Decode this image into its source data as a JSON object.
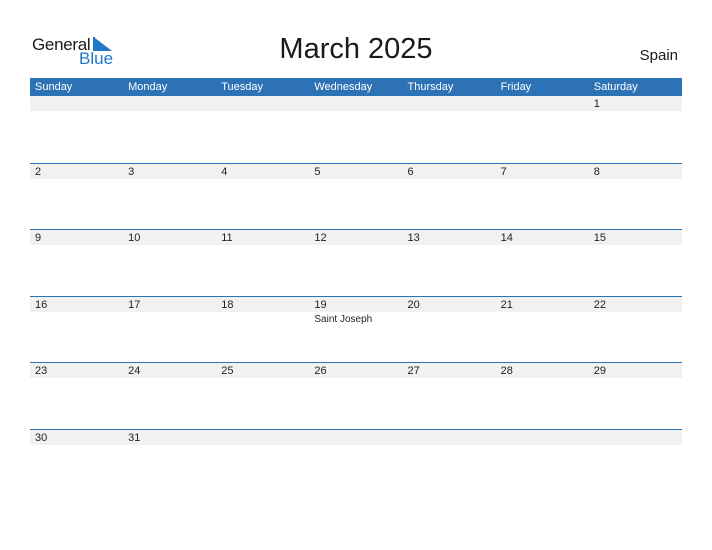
{
  "logo": {
    "word1": "General",
    "word2": "Blue"
  },
  "title": "March 2025",
  "country": "Spain",
  "weekdays": [
    "Sunday",
    "Monday",
    "Tuesday",
    "Wednesday",
    "Thursday",
    "Friday",
    "Saturday"
  ],
  "weeks": [
    [
      {
        "d": ""
      },
      {
        "d": ""
      },
      {
        "d": ""
      },
      {
        "d": ""
      },
      {
        "d": ""
      },
      {
        "d": ""
      },
      {
        "d": "1"
      }
    ],
    [
      {
        "d": "2"
      },
      {
        "d": "3"
      },
      {
        "d": "4"
      },
      {
        "d": "5"
      },
      {
        "d": "6"
      },
      {
        "d": "7"
      },
      {
        "d": "8"
      }
    ],
    [
      {
        "d": "9"
      },
      {
        "d": "10"
      },
      {
        "d": "11"
      },
      {
        "d": "12"
      },
      {
        "d": "13"
      },
      {
        "d": "14"
      },
      {
        "d": "15"
      }
    ],
    [
      {
        "d": "16"
      },
      {
        "d": "17"
      },
      {
        "d": "18"
      },
      {
        "d": "19",
        "ev": "Saint Joseph"
      },
      {
        "d": "20"
      },
      {
        "d": "21"
      },
      {
        "d": "22"
      }
    ],
    [
      {
        "d": "23"
      },
      {
        "d": "24"
      },
      {
        "d": "25"
      },
      {
        "d": "26"
      },
      {
        "d": "27"
      },
      {
        "d": "28"
      },
      {
        "d": "29"
      }
    ],
    [
      {
        "d": "30"
      },
      {
        "d": "31"
      },
      {
        "d": ""
      },
      {
        "d": ""
      },
      {
        "d": ""
      },
      {
        "d": ""
      },
      {
        "d": ""
      }
    ]
  ],
  "colors": {
    "accent": "#2e72b6",
    "strip": "#f1f1f1",
    "logo_blue": "#1f77c8"
  }
}
